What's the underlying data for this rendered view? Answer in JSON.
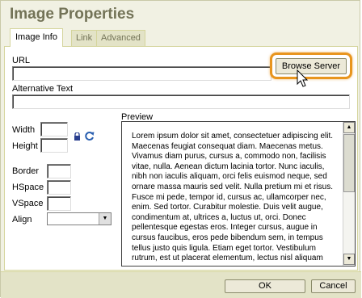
{
  "dialog": {
    "title": "Image Properties"
  },
  "tabs": [
    {
      "label": "Image Info",
      "active": true
    },
    {
      "label": "Link",
      "active": false
    },
    {
      "label": "Advanced",
      "active": false
    }
  ],
  "image_info": {
    "url_label": "URL",
    "url_value": "",
    "browse_label": "Browse Server",
    "alt_label": "Alternative Text",
    "alt_value": "",
    "width_label": "Width",
    "height_label": "Height",
    "width_value": "",
    "height_value": "",
    "border_label": "Border",
    "hspace_label": "HSpace",
    "vspace_label": "VSpace",
    "align_label": "Align",
    "align_value": "",
    "preview_label": "Preview",
    "preview_text": "Lorem ipsum dolor sit amet, consectetuer adipiscing elit. Maecenas feugiat consequat diam. Maecenas metus. Vivamus diam purus, cursus a, commodo non, facilisis vitae, nulla. Aenean dictum lacinia tortor. Nunc iaculis, nibh non iaculis aliquam, orci felis euismod neque, sed ornare massa mauris sed velit. Nulla pretium mi et risus. Fusce mi pede, tempor id, cursus ac, ullamcorper nec, enim. Sed tortor. Curabitur molestie. Duis velit augue, condimentum at, ultrices a, luctus ut, orci. Donec pellentesque egestas eros. Integer cursus, augue in cursus faucibus, eros pede bibendum sem, in tempus tellus justo quis ligula. Etiam eget tortor. Vestibulum rutrum, est ut placerat elementum, lectus nisl aliquam velit, tempor aliquam eros nunc nonummy metus."
  },
  "footer": {
    "ok_label": "OK",
    "cancel_label": "Cancel"
  },
  "colors": {
    "dialog_bg": "#f1f1e3",
    "title": "#737357",
    "highlight": "#e8951e"
  },
  "icons": {
    "lock": "lock-icon",
    "reset": "reset-size-icon",
    "cursor": "mouse-cursor-icon"
  }
}
